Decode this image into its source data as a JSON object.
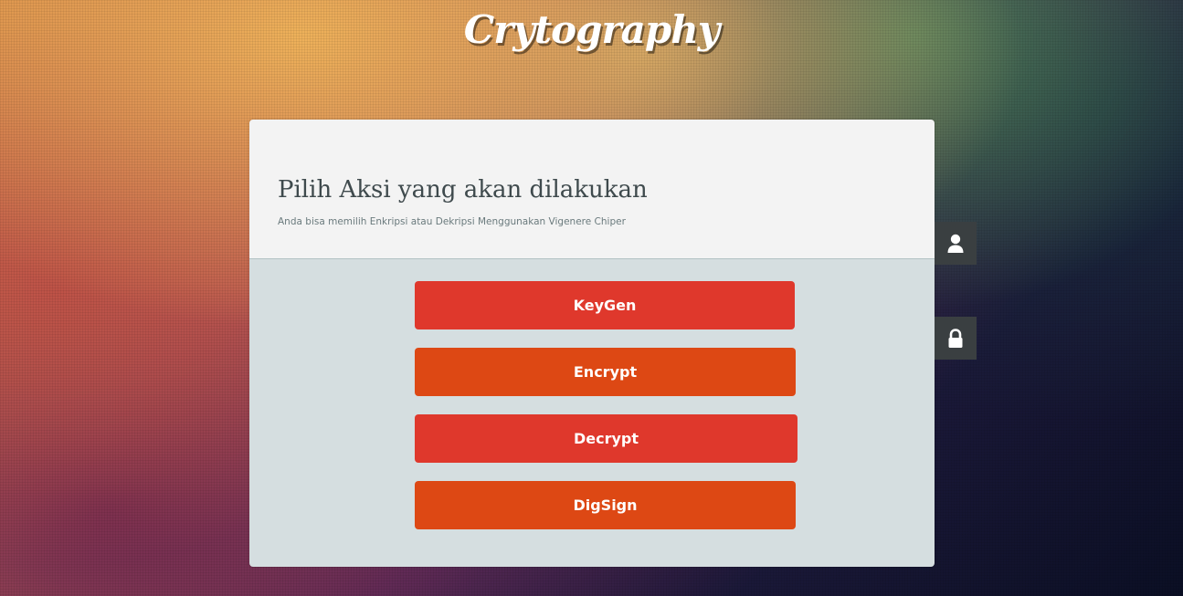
{
  "brand": {
    "title": "Crytography"
  },
  "card": {
    "title": "Pilih Aksi yang akan dilakukan",
    "subtitle": "Anda bisa memilih Enkripsi atau Dekripsi Menggunakan Vigenere Chiper"
  },
  "actions": [
    {
      "label": "KeyGen",
      "color": "#df382c"
    },
    {
      "label": "Encrypt",
      "color": "#dd4814"
    },
    {
      "label": "Decrypt",
      "color": "#df382c"
    },
    {
      "label": "DigSign",
      "color": "#dd4814"
    }
  ],
  "side_tabs": [
    {
      "icon": "user-icon"
    },
    {
      "icon": "lock-icon"
    }
  ],
  "colors": {
    "header_bg": "#f3f3f3",
    "body_bg": "#d5dee0",
    "side_tab_bg": "#3a3f41"
  }
}
